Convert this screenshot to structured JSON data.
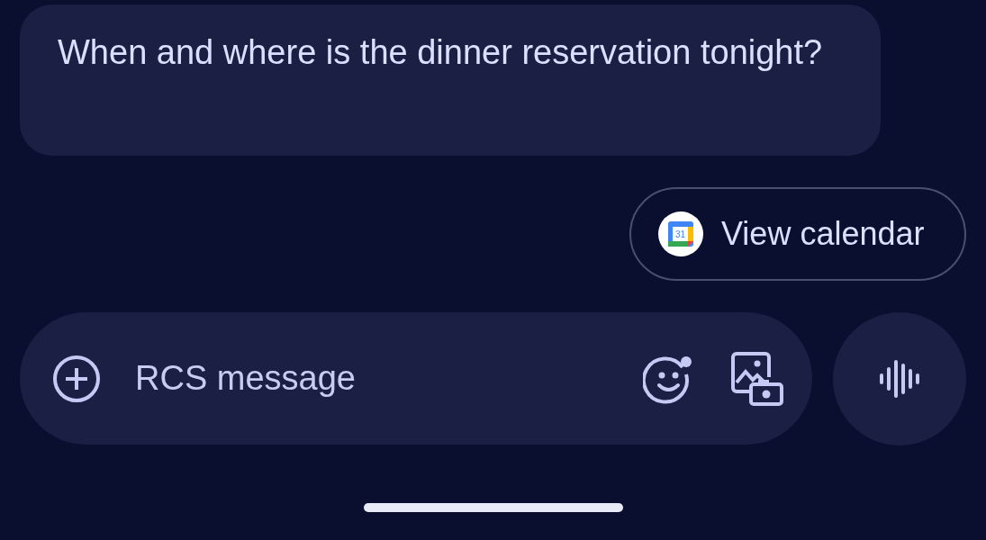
{
  "message": {
    "text": "When and where is the dinner reservation tonight?"
  },
  "suggestion": {
    "label": "View calendar",
    "icon_text": "31"
  },
  "composer": {
    "placeholder": "RCS message"
  }
}
